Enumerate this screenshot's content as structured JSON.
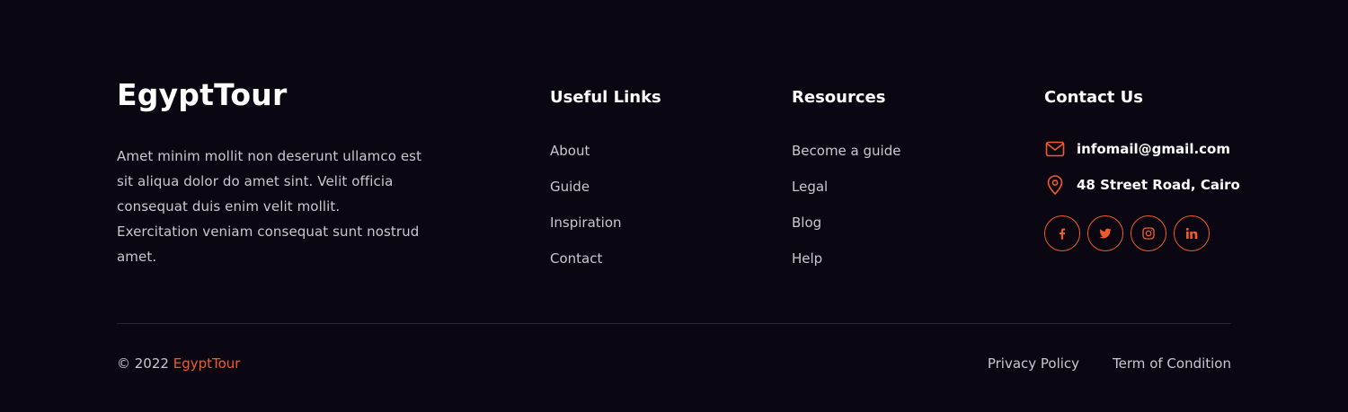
{
  "brand": {
    "name": "EgyptTour"
  },
  "about": {
    "text": "Amet minim mollit non deserunt ullamco est sit aliqua dolor do amet sint. Velit officia consequat duis enim velit mollit. Exercitation veniam consequat sunt nostrud amet."
  },
  "useful_links": {
    "title": "Useful Links",
    "items": [
      {
        "label": "About"
      },
      {
        "label": "Guide"
      },
      {
        "label": "Inspiration"
      },
      {
        "label": "Contact"
      }
    ]
  },
  "resources": {
    "title": "Resources",
    "items": [
      {
        "label": "Become a guide"
      },
      {
        "label": "Legal"
      },
      {
        "label": "Blog"
      },
      {
        "label": "Help"
      }
    ]
  },
  "contact": {
    "title": "Contact Us",
    "email": {
      "icon": "mail-icon",
      "value": "infomail@gmail.com"
    },
    "address": {
      "icon": "location-pin-icon",
      "value": "48 Street Road, Cairo"
    },
    "socials": [
      {
        "icon": "facebook-icon"
      },
      {
        "icon": "twitter-icon"
      },
      {
        "icon": "instagram-icon"
      },
      {
        "icon": "linkedin-icon"
      }
    ]
  },
  "bottom": {
    "copyright_prefix": "© 2022",
    "copyright_brand": "EgyptTour",
    "privacy": "Privacy Policy",
    "terms": "Term of Condition"
  },
  "colors": {
    "background": "#0a0713",
    "accent": "#f05b2c",
    "text_muted": "#c9c7cf",
    "divider": "#2a2733"
  }
}
